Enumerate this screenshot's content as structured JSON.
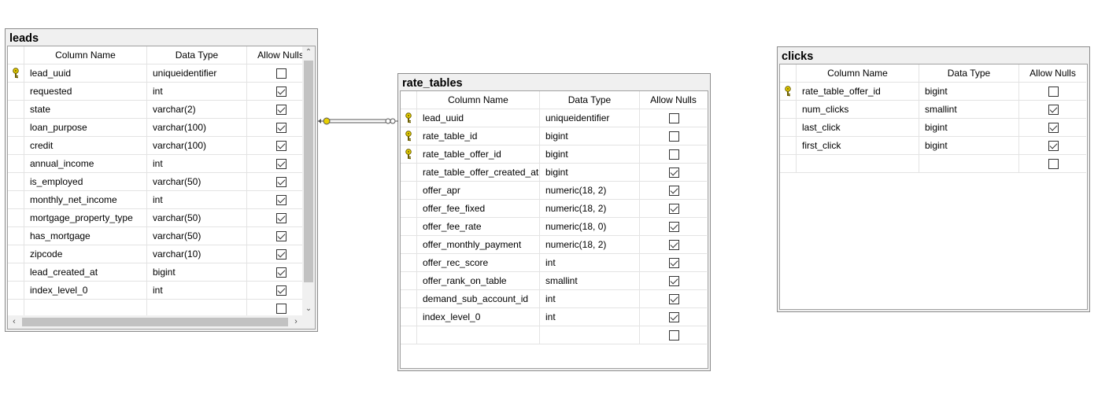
{
  "columns": {
    "name": "Column Name",
    "type": "Data Type",
    "nulls": "Allow Nulls"
  },
  "leads": {
    "title": "leads",
    "rows": [
      {
        "name": "lead_uuid",
        "type": "uniqueidentifier",
        "null": false,
        "key": true
      },
      {
        "name": "requested",
        "type": "int",
        "null": true,
        "key": false
      },
      {
        "name": "state",
        "type": "varchar(2)",
        "null": true,
        "key": false
      },
      {
        "name": "loan_purpose",
        "type": "varchar(100)",
        "null": true,
        "key": false
      },
      {
        "name": "credit",
        "type": "varchar(100)",
        "null": true,
        "key": false
      },
      {
        "name": "annual_income",
        "type": "int",
        "null": true,
        "key": false
      },
      {
        "name": "is_employed",
        "type": "varchar(50)",
        "null": true,
        "key": false
      },
      {
        "name": "monthly_net_income",
        "type": "int",
        "null": true,
        "key": false
      },
      {
        "name": "mortgage_property_type",
        "type": "varchar(50)",
        "null": true,
        "key": false
      },
      {
        "name": "has_mortgage",
        "type": "varchar(50)",
        "null": true,
        "key": false
      },
      {
        "name": "zipcode",
        "type": "varchar(10)",
        "null": true,
        "key": false
      },
      {
        "name": "lead_created_at",
        "type": "bigint",
        "null": true,
        "key": false
      },
      {
        "name": "index_level_0",
        "type": "int",
        "null": true,
        "key": false
      },
      {
        "name": "",
        "type": "",
        "null": false,
        "key": false
      }
    ]
  },
  "rate_tables": {
    "title": "rate_tables",
    "rows": [
      {
        "name": "lead_uuid",
        "type": "uniqueidentifier",
        "null": false,
        "key": true
      },
      {
        "name": "rate_table_id",
        "type": "bigint",
        "null": false,
        "key": true
      },
      {
        "name": "rate_table_offer_id",
        "type": "bigint",
        "null": false,
        "key": true
      },
      {
        "name": "rate_table_offer_created_at",
        "type": "bigint",
        "null": true,
        "key": false
      },
      {
        "name": "offer_apr",
        "type": "numeric(18, 2)",
        "null": true,
        "key": false
      },
      {
        "name": "offer_fee_fixed",
        "type": "numeric(18, 2)",
        "null": true,
        "key": false
      },
      {
        "name": "offer_fee_rate",
        "type": "numeric(18, 0)",
        "null": true,
        "key": false
      },
      {
        "name": "offer_monthly_payment",
        "type": "numeric(18, 2)",
        "null": true,
        "key": false
      },
      {
        "name": "offer_rec_score",
        "type": "int",
        "null": true,
        "key": false
      },
      {
        "name": "offer_rank_on_table",
        "type": "smallint",
        "null": true,
        "key": false
      },
      {
        "name": "demand_sub_account_id",
        "type": "int",
        "null": true,
        "key": false
      },
      {
        "name": "index_level_0",
        "type": "int",
        "null": true,
        "key": false
      },
      {
        "name": "",
        "type": "",
        "null": false,
        "key": false
      }
    ]
  },
  "clicks": {
    "title": "clicks",
    "rows": [
      {
        "name": "rate_table_offer_id",
        "type": "bigint",
        "null": false,
        "key": true
      },
      {
        "name": "num_clicks",
        "type": "smallint",
        "null": true,
        "key": false
      },
      {
        "name": "last_click",
        "type": "bigint",
        "null": true,
        "key": false
      },
      {
        "name": "first_click",
        "type": "bigint",
        "null": true,
        "key": false
      },
      {
        "name": "",
        "type": "",
        "null": false,
        "key": false
      }
    ]
  },
  "icons": {
    "primary_key": "key-icon",
    "checkbox": "checkbox"
  },
  "colors": {
    "key": "#e8d000",
    "relationship_line": "#555555",
    "header_bg": "#f0f0f0"
  }
}
